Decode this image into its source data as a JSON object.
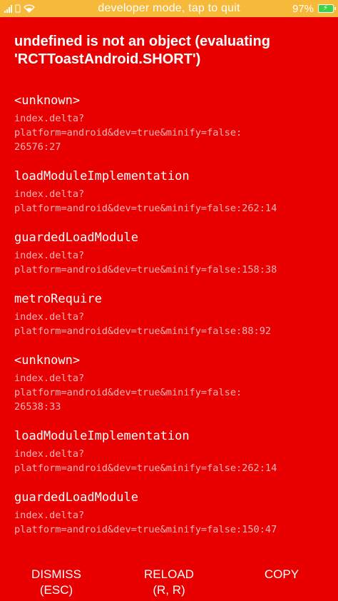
{
  "status_bar": {
    "mode_text": "developer mode, tap to quit",
    "battery": "97%",
    "bg_color": "#f7b93a"
  },
  "error": {
    "title": "undefined is not an object (evaluating 'RCTToastAndroid.SHORT')",
    "bg_color": "#e80000"
  },
  "stack": [
    {
      "method": "<unknown>",
      "file_line1": "index.delta?",
      "file_line2": "platform=android&dev=true&minify=false:",
      "file_line3": "26576:27"
    },
    {
      "method": "loadModuleImplementation",
      "file_line1": "index.delta?",
      "file_line2": "platform=android&dev=true&minify=false:262:14",
      "file_line3": ""
    },
    {
      "method": "guardedLoadModule",
      "file_line1": "index.delta?",
      "file_line2": "platform=android&dev=true&minify=false:158:38",
      "file_line3": ""
    },
    {
      "method": "metroRequire",
      "file_line1": "index.delta?",
      "file_line2": "platform=android&dev=true&minify=false:88:92",
      "file_line3": ""
    },
    {
      "method": "<unknown>",
      "file_line1": "index.delta?",
      "file_line2": "platform=android&dev=true&minify=false:",
      "file_line3": "26538:33"
    },
    {
      "method": "loadModuleImplementation",
      "file_line1": "index.delta?",
      "file_line2": "platform=android&dev=true&minify=false:262:14",
      "file_line3": ""
    },
    {
      "method": "guardedLoadModule",
      "file_line1": "index.delta?",
      "file_line2": "platform=android&dev=true&minify=false:150:47",
      "file_line3": ""
    }
  ],
  "actions": {
    "dismiss_line1": "DISMISS",
    "dismiss_line2": "(ESC)",
    "reload_line1": "RELOAD",
    "reload_line2": "(R, R)",
    "copy": "COPY"
  }
}
